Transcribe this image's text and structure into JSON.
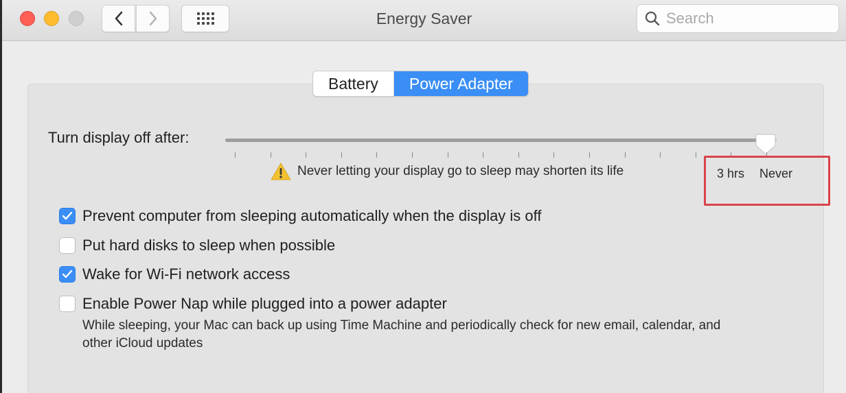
{
  "window": {
    "title": "Energy Saver"
  },
  "search": {
    "placeholder": "Search",
    "value": ""
  },
  "tabs": [
    {
      "label": "Battery",
      "active": false
    },
    {
      "label": "Power Adapter",
      "active": true
    }
  ],
  "display_sleep": {
    "label": "Turn display off after:",
    "slider_value": "Never",
    "slider_fraction": 0.98,
    "warning": "Never letting your display go to sleep may shorten its life",
    "scale_labels": [
      "3 hrs",
      "Never"
    ]
  },
  "options": [
    {
      "label": "Prevent computer from sleeping automatically when the display is off",
      "checked": true
    },
    {
      "label": "Put hard disks to sleep when possible",
      "checked": false
    },
    {
      "label": "Wake for Wi-Fi network access",
      "checked": true
    },
    {
      "label": "Enable Power Nap while plugged into a power adapter",
      "checked": false
    }
  ],
  "power_nap_description": "While sleeping, your Mac can back up using Time Machine and periodically check for new email, calendar, and other iCloud updates",
  "colors": {
    "accent": "#3a8ef6",
    "highlight": "#d9434a",
    "warning": "#f2c230"
  },
  "icons": [
    "back-chevron-icon",
    "forward-chevron-icon",
    "grid-icon",
    "search-icon",
    "warning-icon",
    "checkmark-icon"
  ]
}
